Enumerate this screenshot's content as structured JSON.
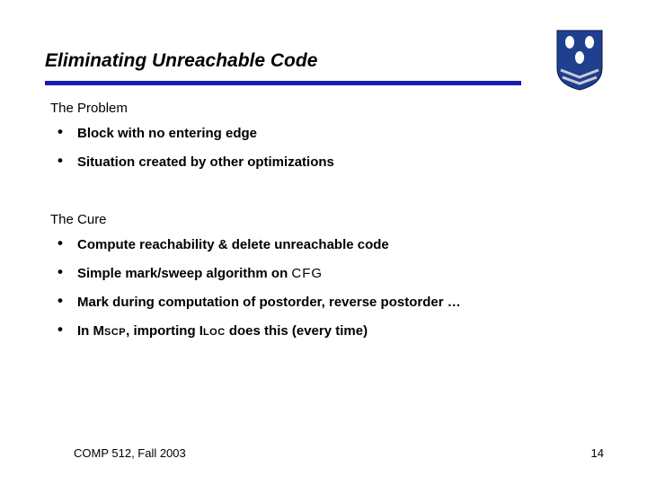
{
  "title": "Eliminating Unreachable Code",
  "sections": {
    "problem": {
      "label": "The Problem",
      "items": [
        "Block with no entering edge",
        "Situation created by other optimizations"
      ]
    },
    "cure": {
      "label": "The Cure",
      "items": [
        "Compute reachability & delete unreachable code",
        "Simple mark/sweep algorithm on CFG",
        "Mark during computation of postorder, reverse postorder …",
        "In MSCP, importing ILOC does this (every time)"
      ]
    }
  },
  "footer": {
    "left": "COMP 512, Fall 2003",
    "right": "14"
  },
  "crest": {
    "bg": "#1f3f8f",
    "owl": "#ffffff",
    "chevron": "#c9cbd6"
  }
}
